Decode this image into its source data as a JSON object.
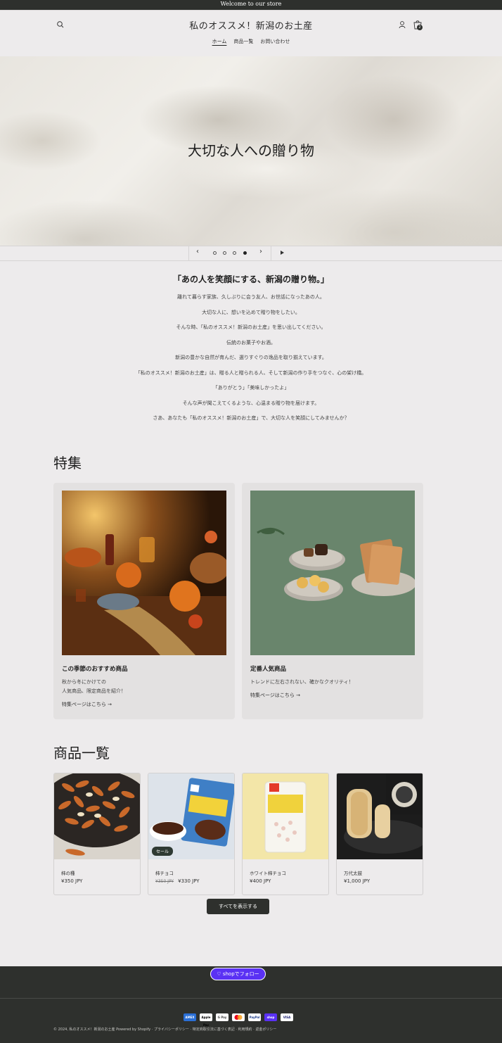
{
  "announcement": "Welcome to our store",
  "header": {
    "site_title": "私のオススメ！新潟のお土産",
    "cart_count": "2",
    "nav": [
      {
        "label": "ホーム",
        "active": true
      },
      {
        "label": "商品一覧",
        "active": false
      },
      {
        "label": "お問い合わせ",
        "active": false
      }
    ]
  },
  "hero": {
    "title": "大切な人への贈り物",
    "slide_count": 4,
    "active_slide": 4,
    "prev_label": "‹",
    "next_label": "›"
  },
  "intro": {
    "heading": "「あの人を笑顔にする、新潟の贈り物。」",
    "lines": [
      "離れて暮らす家族、久しぶりに会う友人、お世話になったあの人。",
      "大切な人に、想いを込めて贈り物をしたい。",
      "そんな時、「私のオススメ！新潟のお土産」を思い出してください。",
      "伝統のお菓子やお酒。",
      "新潟の豊かな自然が育んだ、選りすぐりの逸品を取り揃えています。",
      "「私のオススメ！新潟のお土産」は、贈る人と贈られる人、そして新潟の作り手をつなぐ、心の架け橋。",
      "「ありがとう」「美味しかったよ」",
      "そんな声が聞こえてくるような、心温まる贈り物を届けます。",
      "さあ、あなたも「私のオススメ！新潟のお土産」で、大切な人を笑顔にしてみませんか？"
    ]
  },
  "featured": {
    "title": "特集",
    "cards": [
      {
        "title": "この季節のおすすめ商品",
        "desc_line1": "秋から冬にかけての",
        "desc_line2": "人気商品、限定商品を紹介！",
        "link": "特集ページはこちら →"
      },
      {
        "title": "定番人気商品",
        "desc_line1": "トレンドに左右されない、確かなクオリティ！",
        "desc_line2": "",
        "link": "特集ページはこちら →"
      }
    ]
  },
  "products": {
    "title": "商品一覧",
    "items": [
      {
        "name": "柿の種",
        "price": "¥350 JPY",
        "compare_price": "",
        "badge": ""
      },
      {
        "name": "柿チョコ",
        "price": "¥330 JPY",
        "compare_price": "¥350 JPY",
        "badge": "セール"
      },
      {
        "name": "ホワイト柿チョコ",
        "price": "¥400 JPY",
        "compare_price": "",
        "badge": ""
      },
      {
        "name": "万代太鼓",
        "price": "¥1,000 JPY",
        "compare_price": "",
        "badge": ""
      }
    ],
    "view_all": "すべてを表示する"
  },
  "footer": {
    "follow_label": "shopでフォロー",
    "payments": [
      "AMEX",
      "Apple Pay",
      "G Pay",
      "Master",
      "PayPal",
      "shop",
      "VISA"
    ],
    "copyright": "© 2024, 私のオススメ！新潟のお土産 Powered by Shopify",
    "links": [
      "プライバシーポリシー",
      "特定商取引法に基づく表記",
      "利用規約",
      "返金ポリシー"
    ]
  },
  "colors": {
    "background": "#edebec",
    "dark": "#2e302d",
    "shop_purple": "#5a31f4"
  }
}
